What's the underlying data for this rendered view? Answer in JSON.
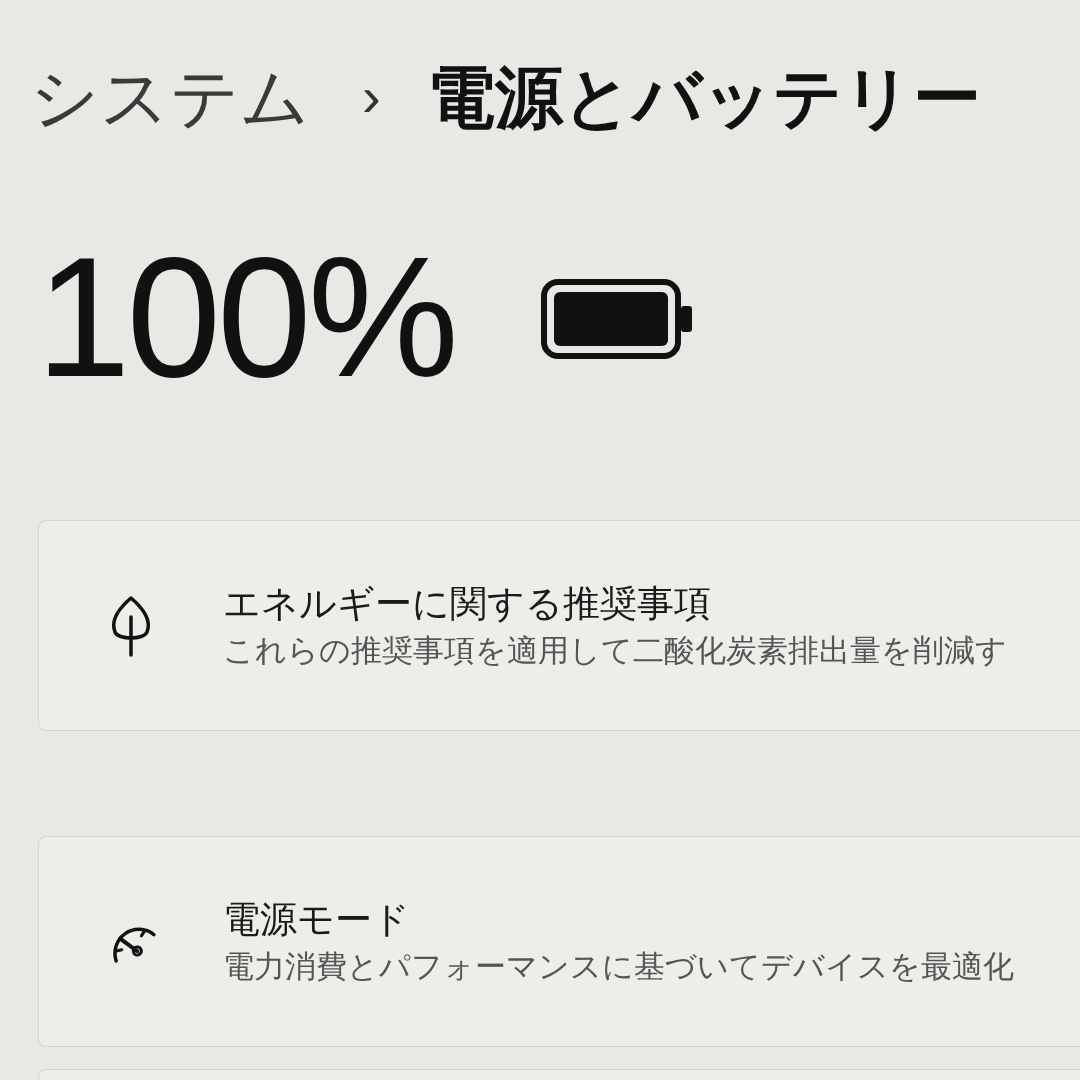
{
  "breadcrumb": {
    "parent": "システム",
    "separator": "›",
    "current": "電源とバッテリー"
  },
  "battery": {
    "percent": "100%"
  },
  "cards": [
    {
      "kind": "leaf",
      "title": "エネルギーに関する推奨事項",
      "description": "これらの推奨事項を適用して二酸化炭素排出量を削減す"
    },
    {
      "kind": "gauge",
      "title": "電源モード",
      "description": "電力消費とパフォーマンスに基づいてデバイスを最適化"
    }
  ]
}
